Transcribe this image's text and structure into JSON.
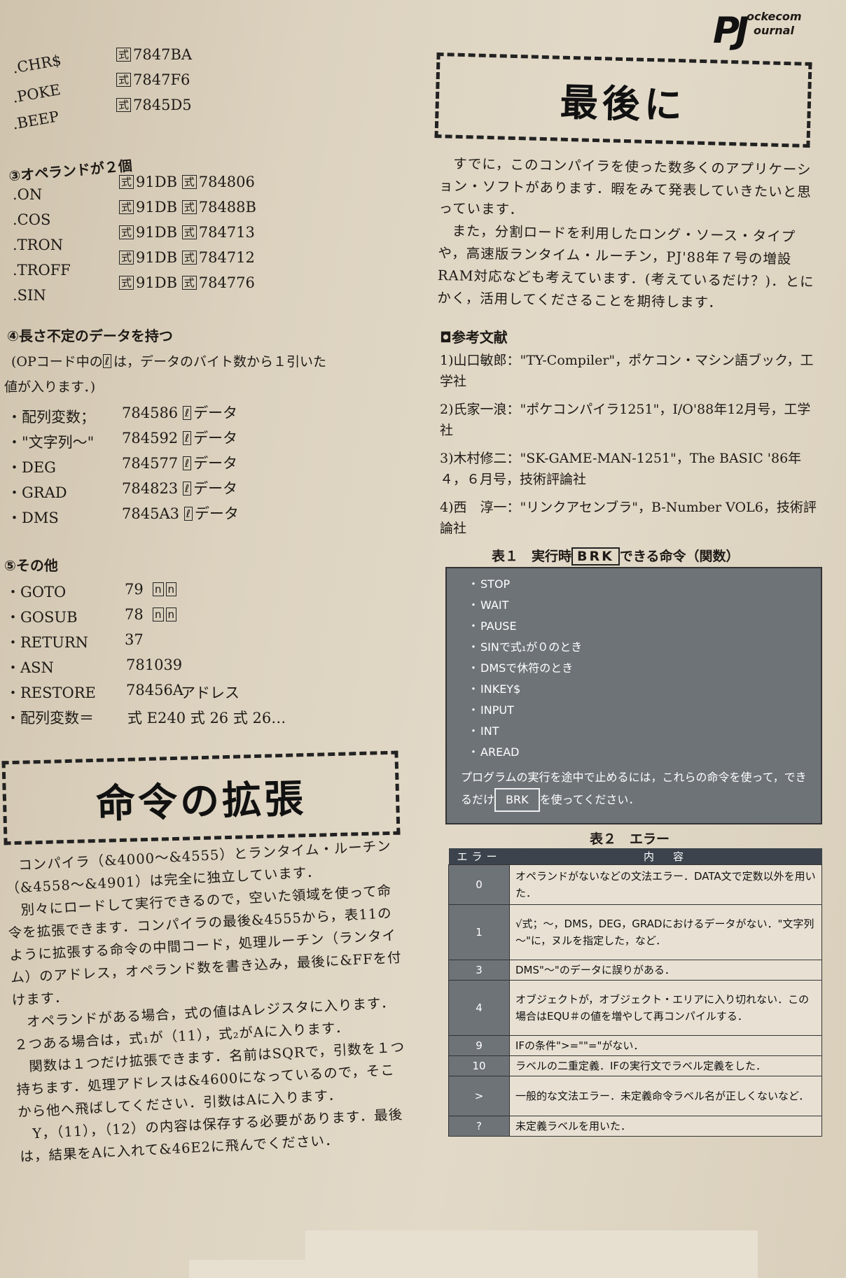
{
  "logo": {
    "pj": "PJ",
    "line1": "ockecom",
    "line2": "ournal"
  },
  "left": {
    "top_items": [
      {
        "name": ".CHR$",
        "box": "式",
        "code": "7847BA"
      },
      {
        "name": ".POKE",
        "box": "式",
        "code": "7847F6"
      },
      {
        "name": ".BEEP",
        "box": "式",
        "code": "7845D5"
      }
    ],
    "sec3_title": "③オペランドが２個",
    "sec3_items": [
      {
        "name": ".ON",
        "box1": "式",
        "mid": "91DB",
        "box2": "式",
        "code": "784806"
      },
      {
        "name": ".COS",
        "box1": "式",
        "mid": "91DB",
        "box2": "式",
        "code": "78488B"
      },
      {
        "name": ".TRON",
        "box1": "式",
        "mid": "91DB",
        "box2": "式",
        "code": "784713"
      },
      {
        "name": ".TROFF",
        "box1": "式",
        "mid": "91DB",
        "box2": "式",
        "code": "784712"
      },
      {
        "name": ".SIN",
        "box1": "式",
        "mid": "91DB",
        "box2": "式",
        "code": "784776"
      }
    ],
    "sec4_title": "④長さ不定のデータを持つ",
    "sec4_note1": "(OPコード中の",
    "sec4_note_box": "ℓ",
    "sec4_note2": "は，データのバイト数から１引いた",
    "sec4_note3": "値が入ります．)",
    "sec4_items": [
      {
        "name": "・配列変数；",
        "code": "784586",
        "box": "ℓ",
        "tail": "データ"
      },
      {
        "name": "・\"文字列～\"",
        "code": "784592",
        "box": "ℓ",
        "tail": "データ"
      },
      {
        "name": "・DEG",
        "code": "784577",
        "box": "ℓ",
        "tail": "データ"
      },
      {
        "name": "・GRAD",
        "code": "784823",
        "box": "ℓ",
        "tail": "データ"
      },
      {
        "name": "・DMS",
        "code": "7845A3",
        "box": "ℓ",
        "tail": "データ"
      }
    ],
    "sec5_title": "⑤その他",
    "sec5_items": [
      {
        "name": "・GOTO",
        "code": "79",
        "extra": "n n"
      },
      {
        "name": "・GOSUB",
        "code": "78",
        "extra": "n n"
      },
      {
        "name": "・RETURN",
        "code": "37",
        "extra": ""
      },
      {
        "name": "・ASN",
        "code": "781039",
        "extra": ""
      },
      {
        "name": "・RESTORE",
        "code": "78456A",
        "extra": "アドレス"
      },
      {
        "name": "・配列変数＝",
        "code": "式 E240 式 26 式 26…",
        "extra": ""
      }
    ],
    "section_title": "命令の拡張",
    "paragraphs": [
      "コンパイラ（&4000～&4555）とランタイム・ルーチン（&4558～&4901）は完全に独立しています．",
      "別々にロードして実行できるので，空いた領域を使って命令を拡張できます．コンパイラの最後&4555から，表11のように拡張する命令の中間コード，処理ルーチン（ランタイム）のアドレス，オペランド数を書き込み，最後に&FFを付けます．",
      "オペランドがある場合，式の値はAレジスタに入ります．２つある場合は，式₁が（11），式₂がAに入ります．",
      "関数は１つだけ拡張できます．名前はSQRで，引数を１つ持ちます．処理アドレスは&4600になっているので，そこから他へ飛ばしてください．引数はAに入ります．",
      "Y，（11），（12）の内容は保存する必要があります．最後は，結果をAに入れて&46E2に飛んでください．"
    ]
  },
  "right": {
    "section_title": "最後に",
    "paragraphs": [
      "すでに，このコンパイラを使った数多くのアプリケーション・ソフトがあります．暇をみて発表していきたいと思っています．",
      "また，分割ロードを利用したロング・ソース・タイプや，高速版ランタイム・ルーチン，PJ'88年７号の増設RAM対応なども考えています．(考えているだけ？)．とにかく，活用してくださることを期待します．"
    ],
    "ref_title": "参考文献",
    "refs": [
      "1)山口敏郎：\"TY-Compiler\"，ポケコン・マシン語ブック，工学社",
      "2)氏家一浪：\"ポケコンパイラ1251\"，I/O'88年12月号，工学社",
      "3)木村修二：\"SK-GAME-MAN-1251\"，The BASIC '86年４，６月号，技術評論社",
      "4)西　淳一：\"リンクアセンブラ\"，B-Number VOL6，技術評論社"
    ],
    "table1": {
      "caption_pre": "表１　実行時",
      "caption_box": "BRK",
      "caption_post": "できる命令（関数）",
      "items": [
        "STOP",
        "WAIT",
        "PAUSE",
        "SINで式₁が０のとき",
        "DMSで休符のとき",
        "INKEY$",
        "INPUT",
        "INT",
        "AREAD"
      ],
      "note_pre": "プログラムの実行を途中で止めるには，これらの命令を使って，できるだけ",
      "note_box": "BRK",
      "note_post": "を使ってください．"
    },
    "table2": {
      "caption": "表２　エラー",
      "headers": [
        "エラー",
        "内　容"
      ],
      "rows": [
        {
          "code": "0",
          "text": "オペランドがないなどの文法エラー．DATA文で定数以外を用いた．"
        },
        {
          "code": "1",
          "text": "√式；～，DMS，DEG，GRADにおけるデータがない．\"文字列～\"に，ヌルを指定した，など．"
        },
        {
          "code": "3",
          "text": "DMS\"～\"のデータに誤りがある．"
        },
        {
          "code": "4",
          "text": "オブジェクトが，オブジェクト・エリアに入り切れない．この場合はEQU＃の値を増やして再コンパイルする．"
        },
        {
          "code": "9",
          "text": "IFの条件\">=\"\"=\"がない．"
        },
        {
          "code": "10",
          "text": "ラベルの二重定義．IFの実行文でラベル定義をした．"
        },
        {
          "code": ">",
          "text": "一般的な文法エラー．未定義命令ラベル名が正しくないなど．"
        },
        {
          "code": "?",
          "text": "未定義ラベルを用いた．"
        }
      ]
    }
  }
}
